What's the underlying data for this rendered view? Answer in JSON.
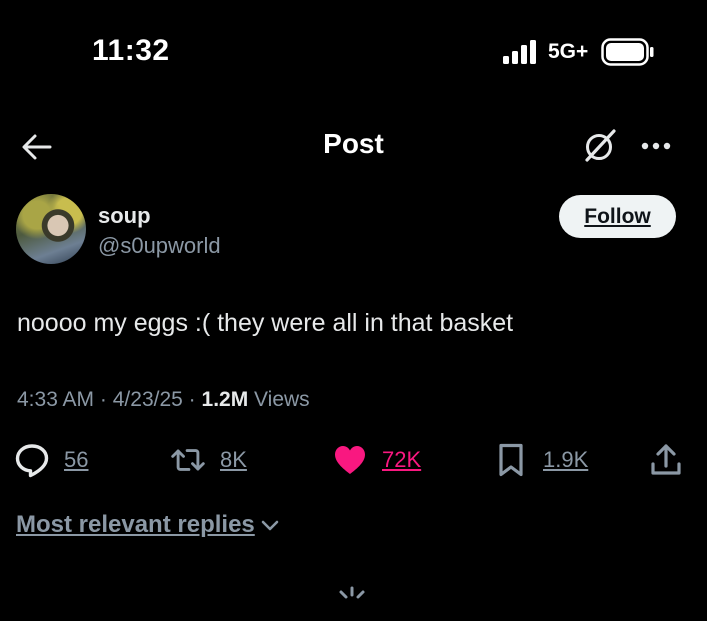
{
  "status_bar": {
    "time": "11:32",
    "network": "5G+"
  },
  "nav": {
    "title": "Post"
  },
  "post": {
    "author_name": "soup",
    "author_handle": "@s0upworld",
    "follow_label": "Follow",
    "text": "noooo my eggs :( they were all in that basket",
    "time": "4:33 AM",
    "date": "4/23/25",
    "views_count": "1.2M",
    "views_label": "Views",
    "replies": "56",
    "reposts": "8K",
    "likes": "72K",
    "bookmarks": "1.9K"
  },
  "replies_filter": {
    "label": "Most relevant replies"
  },
  "colors": {
    "background": "#000000",
    "text": "#e7e9ea",
    "secondary": "#8b98a5",
    "like": "#f91880"
  }
}
